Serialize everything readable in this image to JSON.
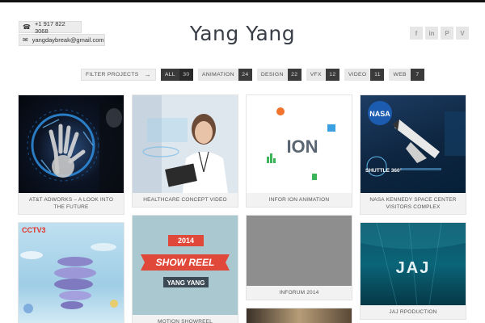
{
  "header": {
    "phone": "+1 917 822 3068",
    "email": "yangdaybreak@gmail.com",
    "brand": "Yang Yang",
    "social": [
      {
        "icon": "facebook-icon",
        "glyph": "f"
      },
      {
        "icon": "linkedin-icon",
        "glyph": "in"
      },
      {
        "icon": "pinterest-icon",
        "glyph": "P"
      },
      {
        "icon": "vimeo-icon",
        "glyph": "V"
      }
    ]
  },
  "filters": {
    "label": "FILTER PROJECTS",
    "arrow": "→",
    "items": [
      {
        "name": "ALL",
        "count": "30",
        "active": true
      },
      {
        "name": "ANIMATION",
        "count": "24"
      },
      {
        "name": "DESIGN",
        "count": "22"
      },
      {
        "name": "VFX",
        "count": "12"
      },
      {
        "name": "VIDEO",
        "count": "11"
      },
      {
        "name": "WEB",
        "count": "7"
      }
    ]
  },
  "projects": [
    {
      "caption": "AT&T ADWORKS – A LOOK INTO THE FUTURE"
    },
    {
      "caption": "HEALTHCARE CONCEPT VIDEO"
    },
    {
      "caption": "INFOR ION ANIMATION",
      "thumb_text": "ION"
    },
    {
      "caption": "NASA KENNEDY SPACE CENTER VISITORS COMPLEX",
      "thumb_text": "NASA",
      "thumb_sub": "SHUTTLE 360°"
    },
    {
      "caption": "",
      "thumb_text": "CCTV3"
    },
    {
      "caption": "MOTION SHOWREEL",
      "thumb_year": "2014",
      "thumb_title": "SHOW REEL",
      "thumb_name": "YANG YANG"
    },
    {
      "caption": "INFORUM 2014"
    },
    {
      "caption": ""
    },
    {
      "caption": "JAJ RPODUCTION",
      "thumb_text": "JAJ"
    }
  ],
  "colors": {
    "dark_badge": "#3a3a3a",
    "light_tag": "#e9e9e9",
    "ribbon_red": "#e0483a"
  }
}
